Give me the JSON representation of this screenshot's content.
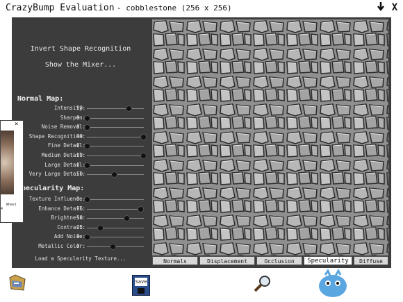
{
  "window": {
    "app_title": "CrazyBump Evaluation",
    "file_title": "- cobblestone (256 x 256)"
  },
  "titlebar_buttons": {
    "down_icon": "download-arrow-icon",
    "close_label": "X"
  },
  "actions": {
    "invert": "Invert Shape Recognition",
    "mixer": "Show the Mixer..."
  },
  "normal_map": {
    "heading": "Normal Map:",
    "sliders": [
      {
        "label": "Intensity:",
        "value": "50",
        "level": 0.73
      },
      {
        "label": "Sharpen:",
        "value": "0",
        "level": 0.0
      },
      {
        "label": "Noise Removal:",
        "value": "0",
        "level": 0.0
      },
      {
        "label": "Shape Recognition:",
        "value": "99",
        "level": 0.99
      },
      {
        "label": "Fine Detail:",
        "value": "0",
        "level": 0.0
      },
      {
        "label": "Medium Detail:",
        "value": "99",
        "level": 0.99
      },
      {
        "label": "Large Detail:",
        "value": "0",
        "level": 0.0
      },
      {
        "label": "Very Large Detail:",
        "value": "50",
        "level": 0.47
      }
    ]
  },
  "specularity_map": {
    "heading": "Specularity Map:",
    "sliders": [
      {
        "label": "Texture Influence:",
        "value": "0",
        "level": 0.0
      },
      {
        "label": "Enhance Detail:",
        "value": "96",
        "level": 0.94
      },
      {
        "label": "Brightness:",
        "value": "50",
        "level": 0.7
      },
      {
        "label": "Contrast:",
        "value": "25",
        "level": 0.23
      },
      {
        "label": "Add Noise:",
        "value": "0",
        "level": 0.0
      },
      {
        "label": "Metallic Color:",
        "value": "0",
        "level": 0.45
      }
    ]
  },
  "load_link": "Load a Specularity Texture...",
  "tabs": [
    {
      "label": "Normals",
      "active": false
    },
    {
      "label": "Displacement",
      "active": false
    },
    {
      "label": "Occlusion",
      "active": false
    },
    {
      "label": "Specularity",
      "active": true
    },
    {
      "label": "Diffuse",
      "active": false
    }
  ],
  "floating_window": {
    "close": "×",
    "label1": "Wheel",
    "label2": "4"
  },
  "bottom": {
    "save_label": "Save",
    "open_icon": "open-folder-icon",
    "zoom_icon": "magnifier-icon",
    "mascot_icon": "mascot-icon"
  },
  "colors": {
    "panel": "#3c3c3c",
    "accent_active_tab": "#ffffff"
  }
}
